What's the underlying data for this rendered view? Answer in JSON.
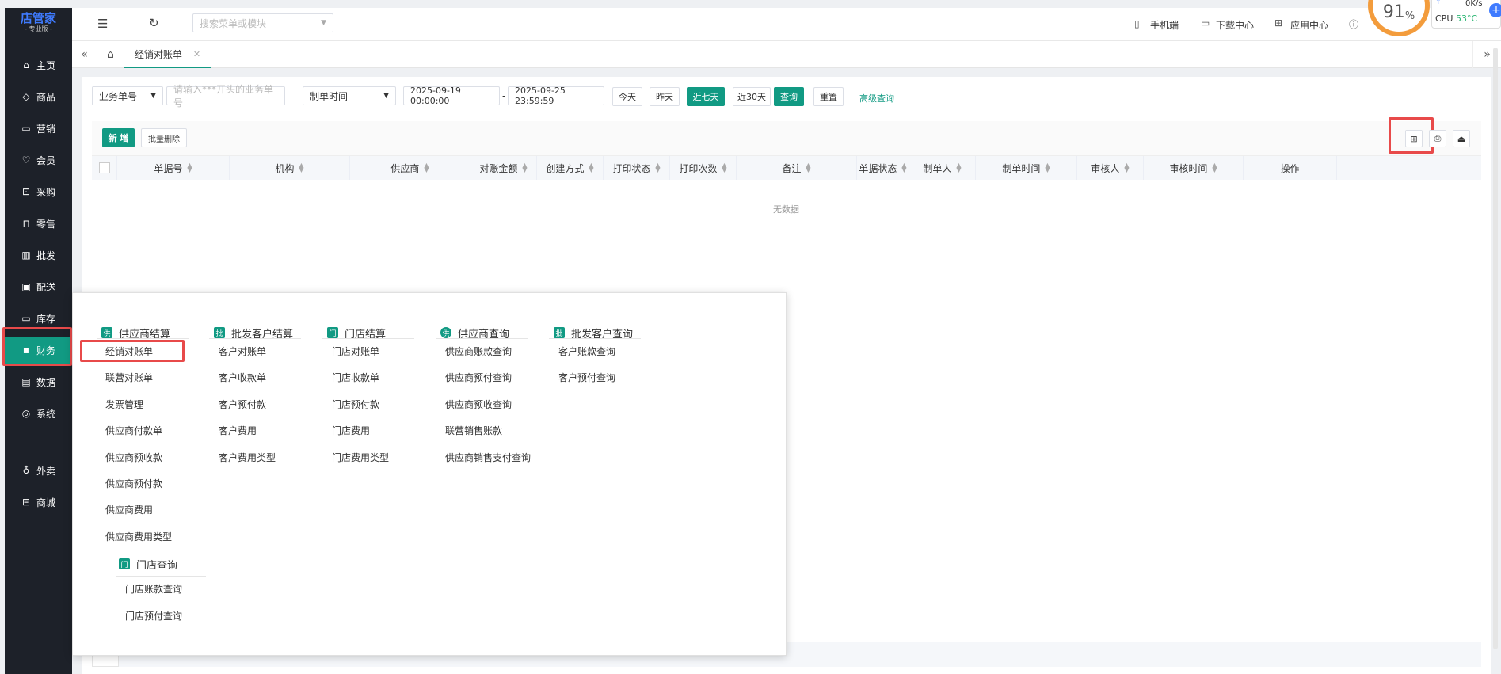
{
  "app": {
    "logo_main": "店管家",
    "logo_sub": "- 专业版 -"
  },
  "sidebar": {
    "items": [
      {
        "label": "主页",
        "icon": "home-icon"
      },
      {
        "label": "商品",
        "icon": "cube-icon"
      },
      {
        "label": "营销",
        "icon": "megaphone-icon"
      },
      {
        "label": "会员",
        "icon": "heart-icon"
      },
      {
        "label": "采购",
        "icon": "cart-icon"
      },
      {
        "label": "零售",
        "icon": "bag-icon"
      },
      {
        "label": "批发",
        "icon": "chart-icon"
      },
      {
        "label": "配送",
        "icon": "truck-icon"
      },
      {
        "label": "库存",
        "icon": "box-icon"
      },
      {
        "label": "财务",
        "icon": "finance-icon",
        "active": true
      },
      {
        "label": "数据",
        "icon": "data-icon"
      },
      {
        "label": "系统",
        "icon": "settings-icon"
      },
      {
        "label": "外卖",
        "icon": "bike-icon"
      },
      {
        "label": "商城",
        "icon": "store-icon"
      }
    ]
  },
  "topbar": {
    "search_placeholder": "搜索菜单或模块",
    "mobile": "手机端",
    "download": "下载中心",
    "apps": "应用中心",
    "cpu_percent": "91",
    "cpu_percent_unit": "%",
    "net_speed": "0K/s",
    "cpu_temp_label": "CPU",
    "cpu_temp": "53°C"
  },
  "tabs": {
    "active": "经销对账单"
  },
  "filters": {
    "doc_field": "业务单号",
    "doc_placeholder": "请输入***开头的业务单号",
    "time_field": "制单时间",
    "date_start": "2025-09-19 00:00:00",
    "date_sep": "-",
    "date_end": "2025-09-25 23:59:59",
    "today": "今天",
    "yesterday": "昨天",
    "last7": "近七天",
    "last30": "近30天",
    "query": "查询",
    "reset": "重置",
    "advanced": "高级查询"
  },
  "toolbar": {
    "add": "新 增",
    "batch_delete": "批量删除"
  },
  "table": {
    "columns": [
      "单据号",
      "机构",
      "供应商",
      "对账金额",
      "创建方式",
      "打印状态",
      "打印次数",
      "备注",
      "单据状态",
      "制单人",
      "制单时间",
      "审核人",
      "审核时间",
      "操作"
    ],
    "empty": "无数据"
  },
  "mega_menu": {
    "columns": [
      {
        "title": "供应商结算",
        "badge": "供",
        "items": [
          "经销对账单",
          "联营对账单",
          "发票管理",
          "供应商付款单",
          "供应商预收款",
          "供应商预付款",
          "供应商费用",
          "供应商费用类型"
        ]
      },
      {
        "title": "批发客户结算",
        "badge": "批",
        "items": [
          "客户对账单",
          "客户收款单",
          "客户预付款",
          "客户费用",
          "客户费用类型"
        ]
      },
      {
        "title": "门店结算",
        "badge": "门",
        "items": [
          "门店对账单",
          "门店收款单",
          "门店预付款",
          "门店费用",
          "门店费用类型"
        ]
      },
      {
        "title": "供应商查询",
        "badge": "供",
        "items": [
          "供应商账款查询",
          "供应商预付查询",
          "供应商预收查询",
          "联营销售账款",
          "供应商销售支付查询"
        ]
      },
      {
        "title": "批发客户查询",
        "badge": "批",
        "items": [
          "客户账款查询",
          "客户预付查询"
        ]
      }
    ],
    "sub_section": {
      "title": "门店查询",
      "badge": "门",
      "items": [
        "门店账款查询",
        "门店预付查询"
      ]
    }
  }
}
